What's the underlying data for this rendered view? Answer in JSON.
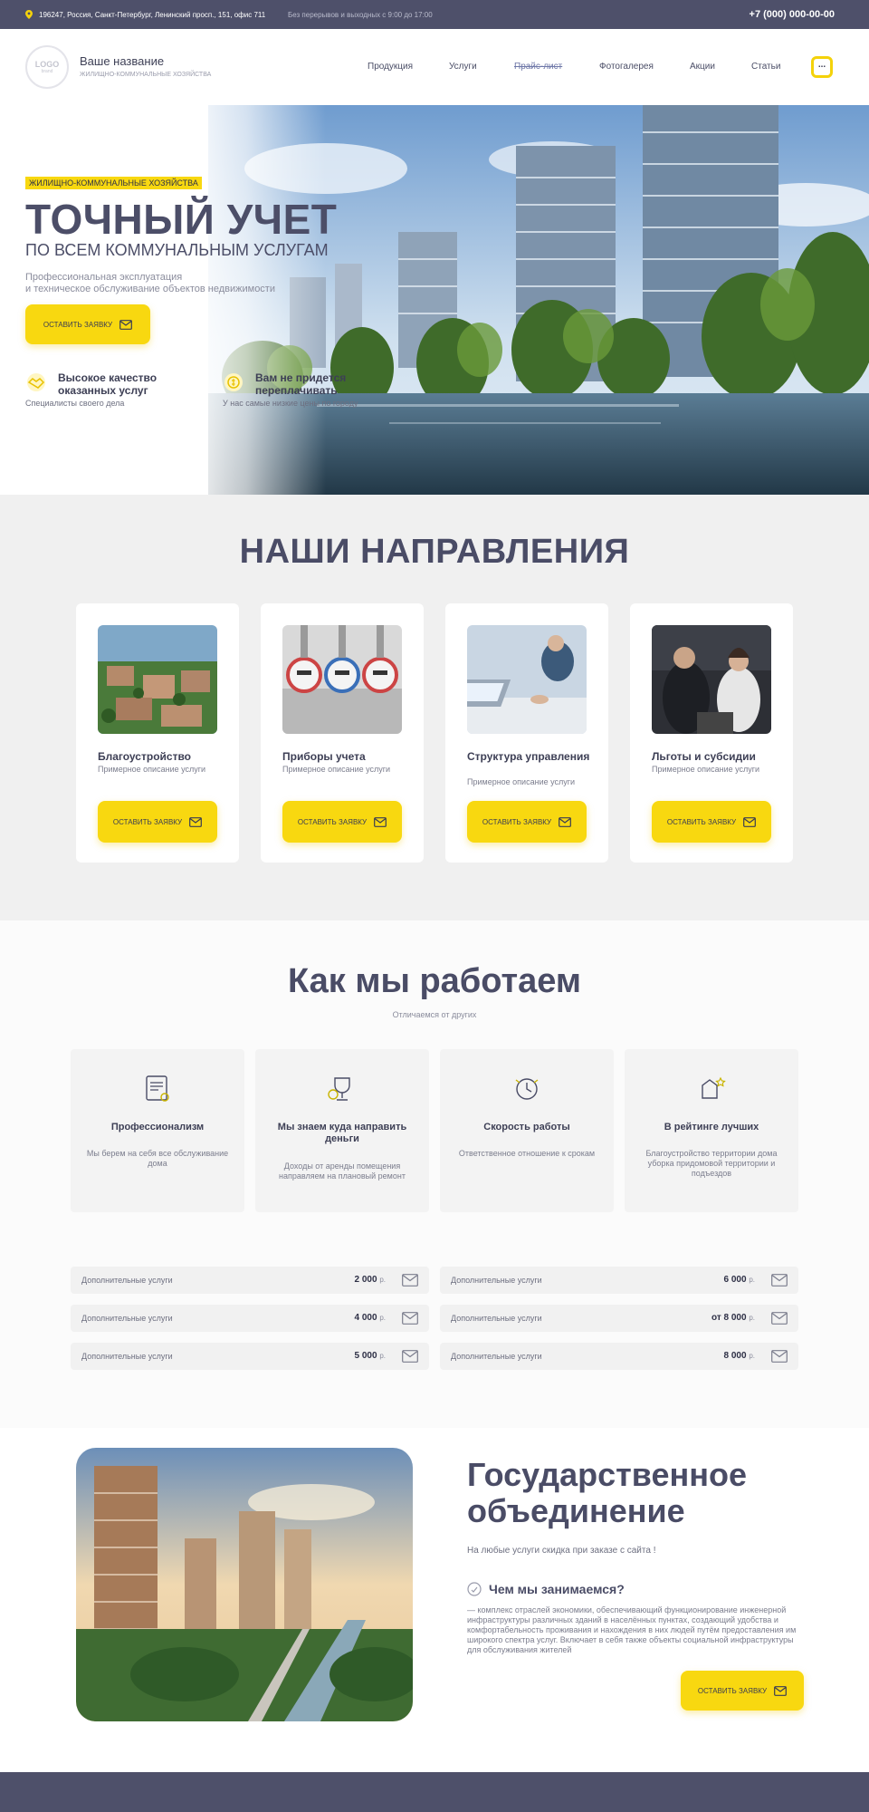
{
  "topbar": {
    "address": "196247, Россия, Санкт-Петербург, Ленинский просп., 151, офис 711",
    "hours": "Без перерывов и выходных с 9:00 до 17:00",
    "phone": "+7 (000) 000-00-00"
  },
  "header": {
    "logo_text": "LOGO",
    "logo_sub": "brand",
    "brand_name": "Ваше название",
    "brand_sub": "ЖИЛИЩНО-КОММУНАЛЬНЫЕ ХОЗЯЙСТВА",
    "nav": [
      "Продукция",
      "Услуги",
      "Прайс-лист",
      "Фотогалерея",
      "Акции",
      "Статьи"
    ],
    "menu_label": "..."
  },
  "hero": {
    "tag": "ЖИЛИЩНО-КОММУНАЛЬНЫЕ ХОЗЯЙСТВА",
    "title": "ТОЧНЫЙ УЧЕТ",
    "subtitle": "ПО ВСЕМ КОММУНАЛЬНЫМ УСЛУГАМ",
    "desc_line1": "Профессиональная эксплуатация",
    "desc_line2": "и техническое обслуживание объектов недвижимости",
    "button": "ОСТАВИТЬ ЗАЯВКУ",
    "features": [
      {
        "icon": "handshake-icon",
        "title": "Высокое качество оказанных услуг",
        "desc": "Специалисты своего дела"
      },
      {
        "icon": "coins-icon",
        "title": "Вам не придется переплачивать",
        "desc": "У нас самые низкие цены по городу"
      }
    ]
  },
  "directions": {
    "title": "НАШИ НАПРАВЛЕНИЯ",
    "cards": [
      {
        "title": "Благоустройство",
        "desc": "Примерное описание услуги",
        "button": "ОСТАВИТЬ ЗАЯВКУ"
      },
      {
        "title": "Приборы учета",
        "desc": "Примерное описание услуги",
        "button": "ОСТАВИТЬ ЗАЯВКУ"
      },
      {
        "title": "Структура управления",
        "desc": "Примерное описание услуги",
        "button": "ОСТАВИТЬ ЗАЯВКУ"
      },
      {
        "title": "Льготы и субсидии",
        "desc": "Примерное описание услуги",
        "button": "ОСТАВИТЬ ЗАЯВКУ"
      }
    ]
  },
  "how": {
    "title": "Как мы работаем",
    "subtitle": "Отличаемся от других",
    "cards": [
      {
        "icon": "certificate-icon",
        "title": "Профессионализм",
        "desc": "Мы берем на себя все обслуживание дома"
      },
      {
        "icon": "money-trophy-icon",
        "title": "Мы знаем куда направить деньги",
        "desc": "Доходы от аренды помещения направляем на плановый ремонт"
      },
      {
        "icon": "clock-icon",
        "title": "Скорость работы",
        "desc": "Ответственное отношение к срокам"
      },
      {
        "icon": "rating-icon",
        "title": "В рейтинге лучших",
        "desc": "Благоустройство территории дома уборка придомовой территории и подъездов"
      }
    ]
  },
  "prices": {
    "currency": "р.",
    "left": [
      {
        "label": "Дополнительные услуги",
        "value": "2 000"
      },
      {
        "label": "Дополнительные услуги",
        "value": "4 000"
      },
      {
        "label": "Дополнительные услуги",
        "value": "5 000"
      }
    ],
    "right": [
      {
        "label": "Дополнительные услуги",
        "value": "6 000"
      },
      {
        "label": "Дополнительные услуги",
        "value": "от 8 000"
      },
      {
        "label": "Дополнительные услуги",
        "value": "8 000"
      }
    ]
  },
  "gov": {
    "title_line1": "Государственное",
    "title_line2": "объединение",
    "promo": "На любые услуги скидка при заказе с сайта !",
    "question": "Чем мы занимаемся?",
    "text": "— комплекс отраслей экономики, обеспечивающий функционирование инженерной инфраструктуры различных зданий в населённых пунктах, создающий удобства и комфортабельность проживания и нахождения в них людей путём предоставления им широкого спектра услуг. Включает в себя также объекты социальной инфраструктуры для обслуживания жителей",
    "button": "ОСТАВИТЬ ЗАЯВКУ"
  },
  "colors": {
    "accent": "#f8d810",
    "dark": "#4e506a",
    "heading": "#4a4c66"
  }
}
